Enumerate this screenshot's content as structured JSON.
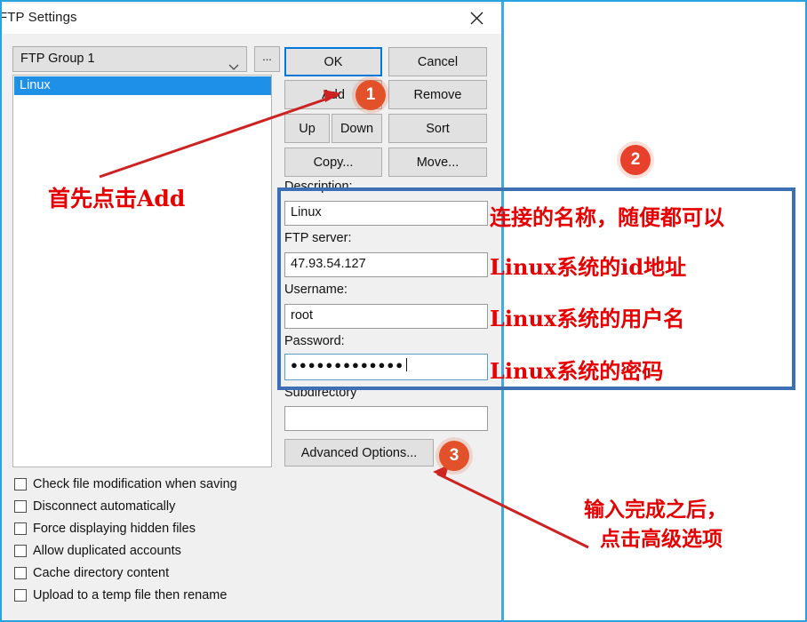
{
  "window": {
    "title": "FTP Settings",
    "close_icon": "close-icon"
  },
  "group": {
    "selected": "FTP Group 1",
    "more_button": "...",
    "chevron_icon": "chevron-down-icon"
  },
  "list": {
    "items": [
      "Linux"
    ]
  },
  "buttons": {
    "ok": "OK",
    "cancel": "Cancel",
    "add": "Add",
    "remove": "Remove",
    "up": "Up",
    "down": "Down",
    "sort": "Sort",
    "copy": "Copy...",
    "move": "Move...",
    "advanced": "Advanced Options..."
  },
  "fields": {
    "description": {
      "label": "Description:",
      "value": "Linux"
    },
    "ftp_server": {
      "label": "FTP server:",
      "value": "47.93.54.127"
    },
    "username": {
      "label": "Username:",
      "value": "root"
    },
    "password": {
      "label": "Password:",
      "value": "●●●●●●●●●●●●●"
    },
    "subdirectory": {
      "label": "Subdirectory",
      "value": ""
    }
  },
  "checkboxes": [
    {
      "label": "Check file modification when saving",
      "checked": false
    },
    {
      "label": "Disconnect automatically",
      "checked": false
    },
    {
      "label": "Force displaying hidden files",
      "checked": false
    },
    {
      "label": "Allow duplicated accounts",
      "checked": false
    },
    {
      "label": "Cache directory content",
      "checked": false
    },
    {
      "label": "Upload to a temp file then rename",
      "checked": false
    }
  ],
  "annotations": {
    "badge_1": "1",
    "badge_2": "2",
    "badge_3": "3",
    "step1_text": "首先点击Add",
    "name_text": "连接的名称，随便都可以",
    "ip_text": "Linux系统的id地址",
    "user_text": "Linux系统的用户名",
    "pass_text": "Linux系统的密码",
    "final_text_line1": "输入完成之后，",
    "final_text_line2": "点击高级选项"
  },
  "colors": {
    "annotation_red": "#e60000",
    "badge_orange": "#e2512a",
    "highlight_blue": "#3d6fb4",
    "frame_blue": "#29a3e0",
    "selection_blue": "#1e90e8",
    "focus_blue": "#0078d7"
  }
}
